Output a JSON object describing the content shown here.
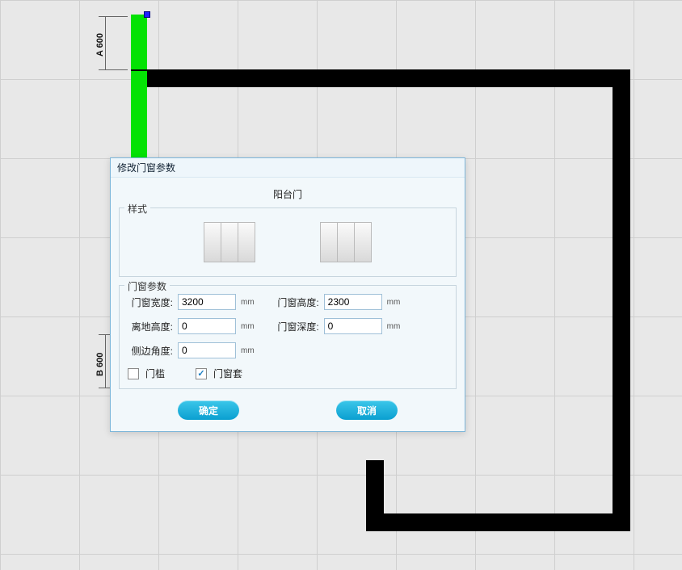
{
  "dialog": {
    "title": "修改门窗参数",
    "subtitle": "阳台门",
    "style_legend": "样式",
    "param_legend": "门窗参数",
    "width_label": "门窗宽度:",
    "width_value": "3200",
    "height_label": "门窗高度:",
    "height_value": "2300",
    "elev_label": "离地高度:",
    "elev_value": "0",
    "depth_label": "门窗深度:",
    "depth_value": "0",
    "angle_label": "侧边角度:",
    "angle_value": "0",
    "unit": "mm",
    "threshold_label": "门槛",
    "casing_label": "门窗套",
    "ok": "确定",
    "cancel": "取消"
  },
  "dims": {
    "a": "A 600",
    "b": "B 600"
  }
}
